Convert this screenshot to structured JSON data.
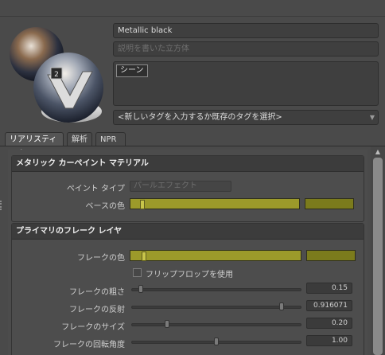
{
  "material": {
    "name": "Metallic black",
    "description_placeholder": "説明を書いた立方体",
    "scene_button": "シーン",
    "tag_placeholder": "<新しいタグを入力するか既存のタグを選択>",
    "preview_badge": "2"
  },
  "tabs": [
    "リアリスティック",
    "解析",
    "NPR"
  ],
  "sections": {
    "carpaint": {
      "title": "メタリック カーペイント マテリアル",
      "paint_type_label": "ペイント タイプ",
      "paint_type_value": "パールエフェクト",
      "base_color_label": "ベースの色"
    },
    "flake": {
      "title": "プライマリのフレーク レイヤ",
      "flake_color_label": "フレークの色",
      "flipflop_label": "フリップフロップを使用",
      "sliders": [
        {
          "label": "フレークの粗さ",
          "value": "0.15",
          "fraction": 0.04
        },
        {
          "label": "フレークの反射",
          "value": "0.916071",
          "fraction": 0.9
        },
        {
          "label": "フレークのサイズ",
          "value": "0.20",
          "fraction": 0.2
        },
        {
          "label": "フレークの回転角度",
          "value": "1.00",
          "fraction": 0.5
        }
      ]
    }
  },
  "colors": {
    "base_color": "#9c9a2a",
    "base_swatch": "#7b7b1c",
    "flake_color": "#9c9a2a",
    "flake_swatch": "#7b7b1c"
  },
  "icons": {
    "scroll_up": "triangle-up",
    "dropdown": "chevron-down"
  }
}
